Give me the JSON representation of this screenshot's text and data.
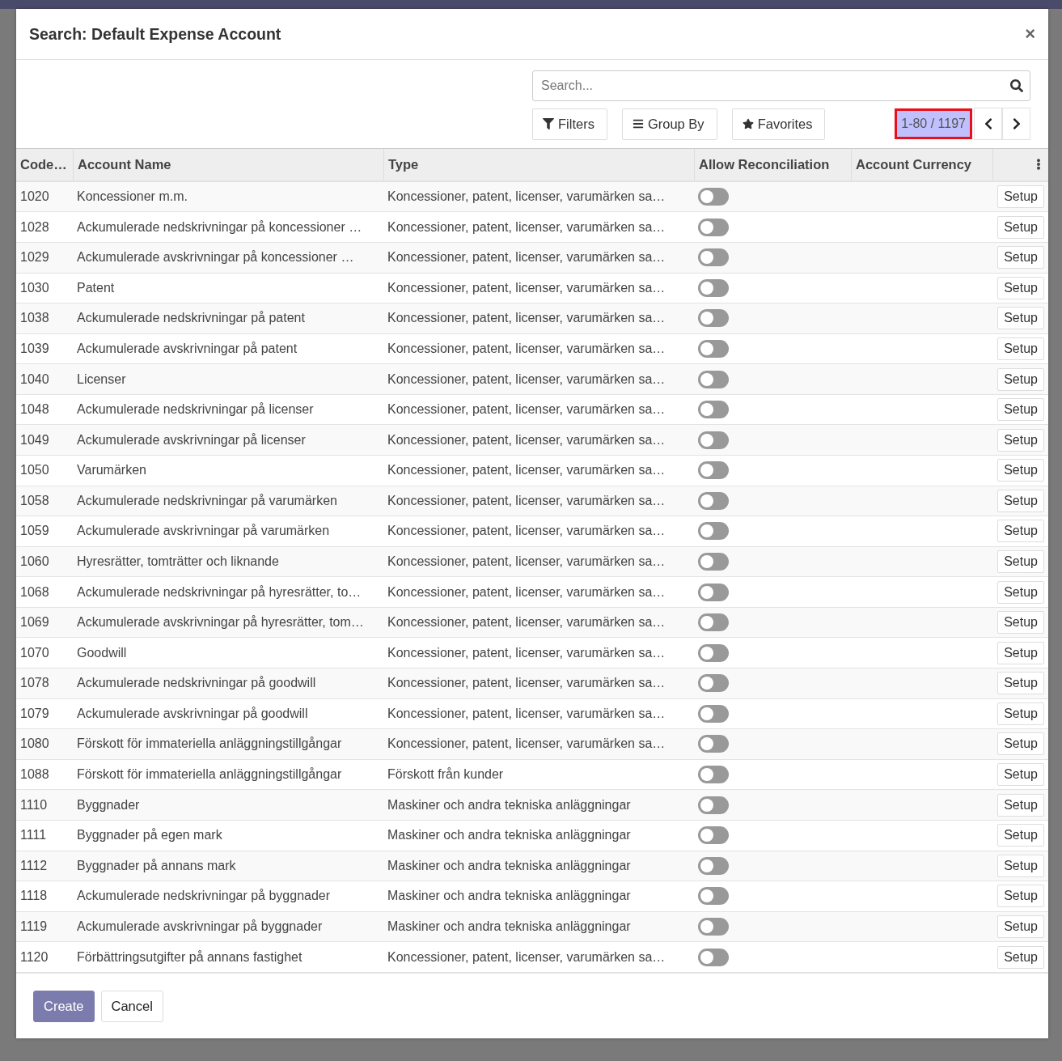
{
  "dialog": {
    "title": "Search: Default Expense Account",
    "close": "×"
  },
  "search": {
    "placeholder": "Search..."
  },
  "filters": [
    {
      "kind": "filter",
      "label": "Filters"
    },
    {
      "kind": "group",
      "label": "Group By"
    },
    {
      "kind": "star",
      "label": "Favorites"
    }
  ],
  "pager": {
    "range": "1-80 / 1197",
    "highlighted": true
  },
  "table": {
    "columns": [
      "Code…",
      "Account Name",
      "Type",
      "Allow Reconciliation",
      "Account Currency"
    ],
    "rows": [
      {
        "code": "1020",
        "name": "Koncessioner m.m.",
        "type": "Koncessioner, patent, licenser, varumärken sa…",
        "reconcile": false,
        "action": "Setup"
      },
      {
        "code": "1028",
        "name": "Ackumulerade nedskrivningar på koncessioner …",
        "type": "Koncessioner, patent, licenser, varumärken sa…",
        "reconcile": false,
        "action": "Setup"
      },
      {
        "code": "1029",
        "name": "Ackumulerade avskrivningar på koncessioner …",
        "type": "Koncessioner, patent, licenser, varumärken sa…",
        "reconcile": false,
        "action": "Setup"
      },
      {
        "code": "1030",
        "name": "Patent",
        "type": "Koncessioner, patent, licenser, varumärken sa…",
        "reconcile": false,
        "action": "Setup"
      },
      {
        "code": "1038",
        "name": "Ackumulerade nedskrivningar på patent",
        "type": "Koncessioner, patent, licenser, varumärken sa…",
        "reconcile": false,
        "action": "Setup"
      },
      {
        "code": "1039",
        "name": "Ackumulerade avskrivningar på patent",
        "type": "Koncessioner, patent, licenser, varumärken sa…",
        "reconcile": false,
        "action": "Setup"
      },
      {
        "code": "1040",
        "name": "Licenser",
        "type": "Koncessioner, patent, licenser, varumärken sa…",
        "reconcile": false,
        "action": "Setup"
      },
      {
        "code": "1048",
        "name": "Ackumulerade nedskrivningar på licenser",
        "type": "Koncessioner, patent, licenser, varumärken sa…",
        "reconcile": false,
        "action": "Setup"
      },
      {
        "code": "1049",
        "name": "Ackumulerade avskrivningar på licenser",
        "type": "Koncessioner, patent, licenser, varumärken sa…",
        "reconcile": false,
        "action": "Setup"
      },
      {
        "code": "1050",
        "name": "Varumärken",
        "type": "Koncessioner, patent, licenser, varumärken sa…",
        "reconcile": false,
        "action": "Setup"
      },
      {
        "code": "1058",
        "name": "Ackumulerade nedskrivningar på varumärken",
        "type": "Koncessioner, patent, licenser, varumärken sa…",
        "reconcile": false,
        "action": "Setup"
      },
      {
        "code": "1059",
        "name": "Ackumulerade avskrivningar på varumärken",
        "type": "Koncessioner, patent, licenser, varumärken sa…",
        "reconcile": false,
        "action": "Setup"
      },
      {
        "code": "1060",
        "name": "Hyresrätter, tomträtter och liknande",
        "type": "Koncessioner, patent, licenser, varumärken sa…",
        "reconcile": false,
        "action": "Setup"
      },
      {
        "code": "1068",
        "name": "Ackumulerade nedskrivningar på hyresrätter, to…",
        "type": "Koncessioner, patent, licenser, varumärken sa…",
        "reconcile": false,
        "action": "Setup"
      },
      {
        "code": "1069",
        "name": "Ackumulerade avskrivningar på hyresrätter, tom…",
        "type": "Koncessioner, patent, licenser, varumärken sa…",
        "reconcile": false,
        "action": "Setup"
      },
      {
        "code": "1070",
        "name": "Goodwill",
        "type": "Koncessioner, patent, licenser, varumärken sa…",
        "reconcile": false,
        "action": "Setup"
      },
      {
        "code": "1078",
        "name": "Ackumulerade nedskrivningar på goodwill",
        "type": "Koncessioner, patent, licenser, varumärken sa…",
        "reconcile": false,
        "action": "Setup"
      },
      {
        "code": "1079",
        "name": "Ackumulerade avskrivningar på goodwill",
        "type": "Koncessioner, patent, licenser, varumärken sa…",
        "reconcile": false,
        "action": "Setup"
      },
      {
        "code": "1080",
        "name": "Förskott för immateriella anläggningstillgångar",
        "type": "Koncessioner, patent, licenser, varumärken sa…",
        "reconcile": false,
        "action": "Setup"
      },
      {
        "code": "1088",
        "name": "Förskott för immateriella anläggningstillgångar",
        "type": "Förskott från kunder",
        "reconcile": false,
        "action": "Setup"
      },
      {
        "code": "1110",
        "name": "Byggnader",
        "type": "Maskiner och andra tekniska anläggningar",
        "reconcile": false,
        "action": "Setup"
      },
      {
        "code": "1111",
        "name": "Byggnader på egen mark",
        "type": "Maskiner och andra tekniska anläggningar",
        "reconcile": false,
        "action": "Setup"
      },
      {
        "code": "1112",
        "name": "Byggnader på annans mark",
        "type": "Maskiner och andra tekniska anläggningar",
        "reconcile": false,
        "action": "Setup"
      },
      {
        "code": "1118",
        "name": "Ackumulerade nedskrivningar på byggnader",
        "type": "Maskiner och andra tekniska anläggningar",
        "reconcile": false,
        "action": "Setup"
      },
      {
        "code": "1119",
        "name": "Ackumulerade avskrivningar på byggnader",
        "type": "Maskiner och andra tekniska anläggningar",
        "reconcile": false,
        "action": "Setup"
      },
      {
        "code": "1120",
        "name": "Förbättringsutgifter på annans fastighet",
        "type": "Koncessioner, patent, licenser, varumärken sa…",
        "reconcile": false,
        "action": "Setup"
      }
    ]
  },
  "buttons": [
    {
      "kind": "primary",
      "label": "Create"
    },
    {
      "kind": "secondary",
      "label": "Cancel"
    }
  ]
}
